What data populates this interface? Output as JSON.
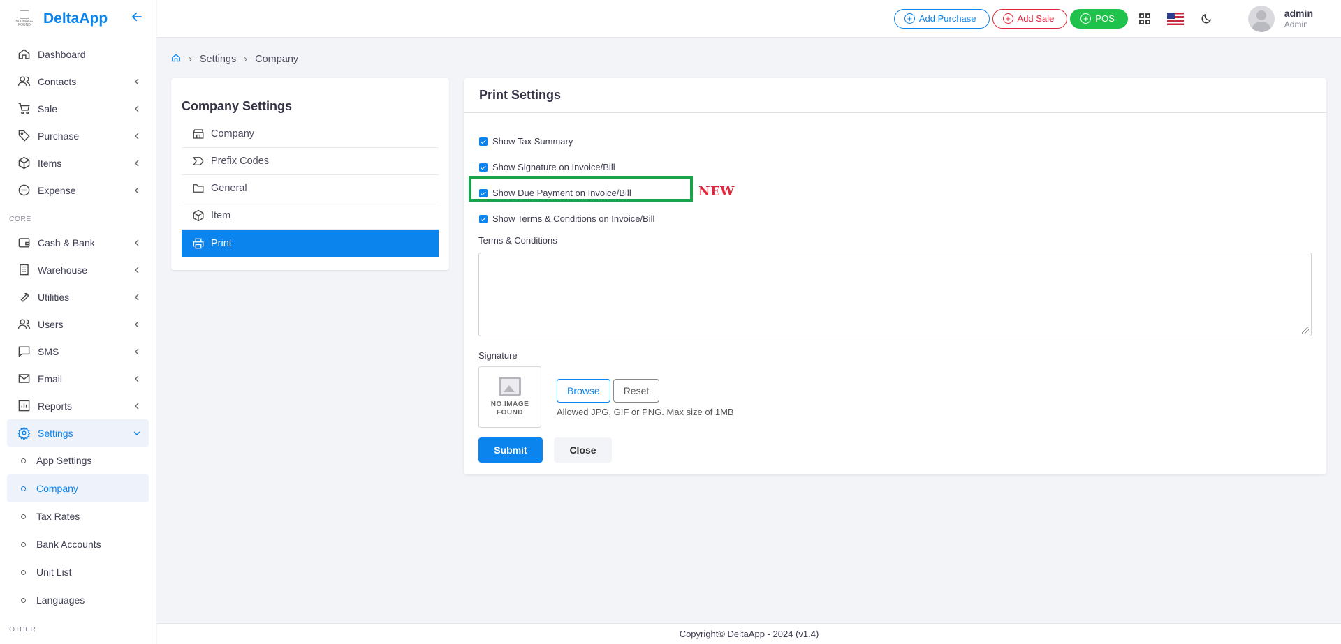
{
  "brand": {
    "name": "DeltaApp",
    "logo_text": "NO IMAGE FOUND"
  },
  "sidebar": {
    "main": [
      {
        "label": "Dashboard"
      },
      {
        "label": "Contacts"
      },
      {
        "label": "Sale"
      },
      {
        "label": "Purchase"
      },
      {
        "label": "Items"
      },
      {
        "label": "Expense"
      }
    ],
    "core_label": "CORE",
    "core": [
      {
        "label": "Cash & Bank"
      },
      {
        "label": "Warehouse"
      },
      {
        "label": "Utilities"
      },
      {
        "label": "Users"
      },
      {
        "label": "SMS"
      },
      {
        "label": "Email"
      },
      {
        "label": "Reports"
      },
      {
        "label": "Settings"
      }
    ],
    "settings_sub": [
      {
        "label": "App Settings"
      },
      {
        "label": "Company"
      },
      {
        "label": "Tax Rates"
      },
      {
        "label": "Bank Accounts"
      },
      {
        "label": "Unit List"
      },
      {
        "label": "Languages"
      }
    ],
    "other_label": "OTHER"
  },
  "topbar": {
    "add_purchase": "Add Purchase",
    "add_sale": "Add Sale",
    "pos": "POS",
    "user_name": "admin",
    "user_role": "Admin"
  },
  "breadcrumb": {
    "level1": "Settings",
    "level2": "Company"
  },
  "company_settings": {
    "title": "Company Settings",
    "items": [
      {
        "label": "Company"
      },
      {
        "label": "Prefix Codes"
      },
      {
        "label": "General"
      },
      {
        "label": "Item"
      },
      {
        "label": "Print"
      }
    ]
  },
  "print_settings": {
    "title": "Print Settings",
    "checks": [
      {
        "label": "Show Tax Summary"
      },
      {
        "label": "Show Signature on Invoice/Bill"
      },
      {
        "label": "Show Due Payment on Invoice/Bill"
      },
      {
        "label": "Show Terms & Conditions on Invoice/Bill"
      }
    ],
    "new_tag": "NEW",
    "terms_label": "Terms & Conditions",
    "terms_value": "",
    "signature_label": "Signature",
    "no_image_text": "NO IMAGE FOUND",
    "browse": "Browse",
    "reset": "Reset",
    "hint": "Allowed JPG, GIF or PNG. Max size of 1MB",
    "submit": "Submit",
    "close": "Close"
  },
  "footer": {
    "text": "Copyright© DeltaApp - 2024 (v1.4)"
  },
  "colors": {
    "primary": "#0b84ee",
    "danger": "#e0263a",
    "success": "#1fc24a",
    "highlight": "#1aa34a"
  }
}
